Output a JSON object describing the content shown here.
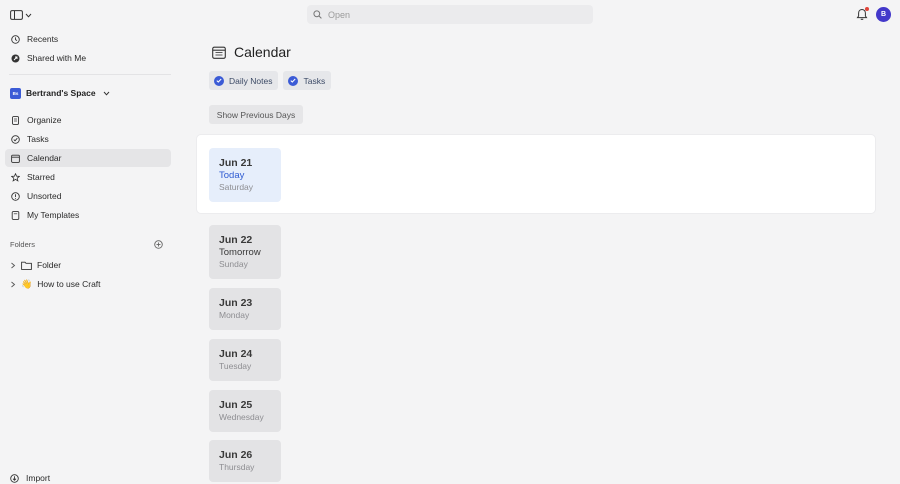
{
  "topbar": {
    "search_placeholder": "Open",
    "avatar_initial": "B",
    "notification_dot_color": "#e0453a",
    "icons": [
      "sidebar-toggle-icon",
      "chevron-down-icon",
      "search-icon",
      "bell-icon"
    ]
  },
  "sidebar": {
    "top_items": [
      {
        "label": "Recents",
        "icon": "clock-icon"
      },
      {
        "label": "Shared with Me",
        "icon": "share-icon"
      }
    ],
    "space": {
      "name": "Bertrand's Space",
      "badge": "Bs"
    },
    "nav_items": [
      {
        "label": "Organize",
        "icon": "document-icon"
      },
      {
        "label": "Tasks",
        "icon": "check-circle-icon"
      },
      {
        "label": "Calendar",
        "icon": "calendar-icon",
        "active": true
      },
      {
        "label": "Starred",
        "icon": "star-icon"
      },
      {
        "label": "Unsorted",
        "icon": "inbox-icon"
      },
      {
        "label": "My Templates",
        "icon": "template-icon"
      }
    ],
    "folders_label": "Folders",
    "folders": [
      {
        "label": "Folder",
        "icon": "folder-icon"
      },
      {
        "label": "How to use Craft",
        "icon": "wave-emoji",
        "emoji": "👋"
      }
    ],
    "import_label": "Import"
  },
  "main": {
    "title": "Calendar",
    "filters": [
      {
        "label": "Daily Notes",
        "checked": true
      },
      {
        "label": "Tasks",
        "checked": true
      }
    ],
    "show_previous_label": "Show Previous Days",
    "days": [
      {
        "date": "Jun 21",
        "relative": "Today",
        "weekday": "Saturday",
        "today": true
      },
      {
        "date": "Jun 22",
        "relative": "Tomorrow",
        "weekday": "Sunday"
      },
      {
        "date": "Jun 23",
        "relative": "",
        "weekday": "Monday"
      },
      {
        "date": "Jun 24",
        "relative": "",
        "weekday": "Tuesday"
      },
      {
        "date": "Jun 25",
        "relative": "",
        "weekday": "Wednesday"
      },
      {
        "date": "Jun 26",
        "relative": "",
        "weekday": "Thursday"
      }
    ]
  },
  "colors": {
    "accent": "#3b5bd6",
    "today_text": "#2f5bd2",
    "today_card": "#e6eefb",
    "background": "#f4f4f5"
  }
}
